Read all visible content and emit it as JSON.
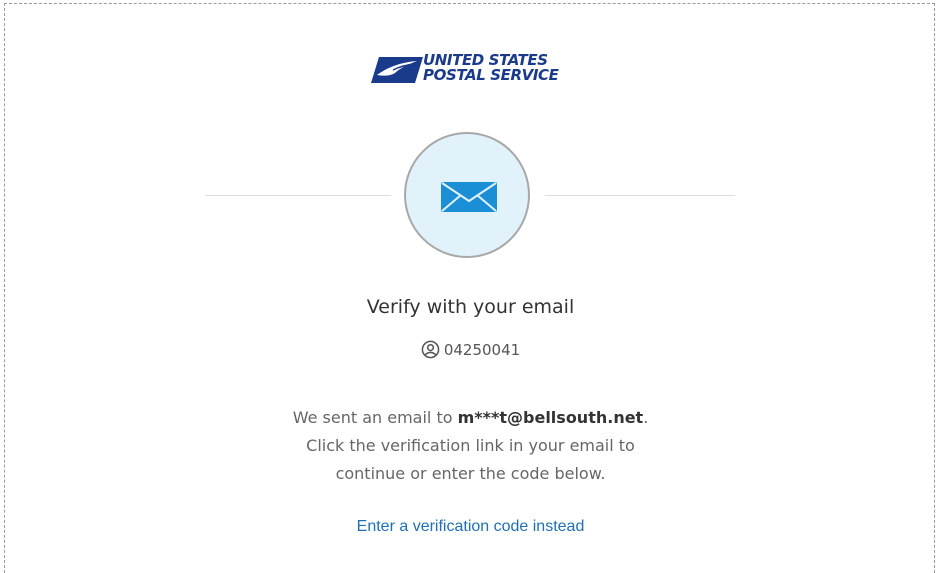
{
  "brand": {
    "line1": "UNITED STATES",
    "line2": "POSTAL SERVICE",
    "icon": "eagle-logo-icon",
    "color": "#1a3a8c"
  },
  "verification": {
    "icon": "mail-icon",
    "title": "Verify with your email",
    "user_icon": "user-circle-icon",
    "username": "04250041",
    "message_prefix": "We sent an email to ",
    "email": "m***t@bellsouth.net",
    "message_suffix": ".",
    "message_line2": "Click the verification link in your email to",
    "message_line3": "continue or enter the code below.",
    "link_label": "Enter a verification code instead",
    "link_color": "#1f6fb5",
    "circle_color": "#e1f2fb"
  }
}
